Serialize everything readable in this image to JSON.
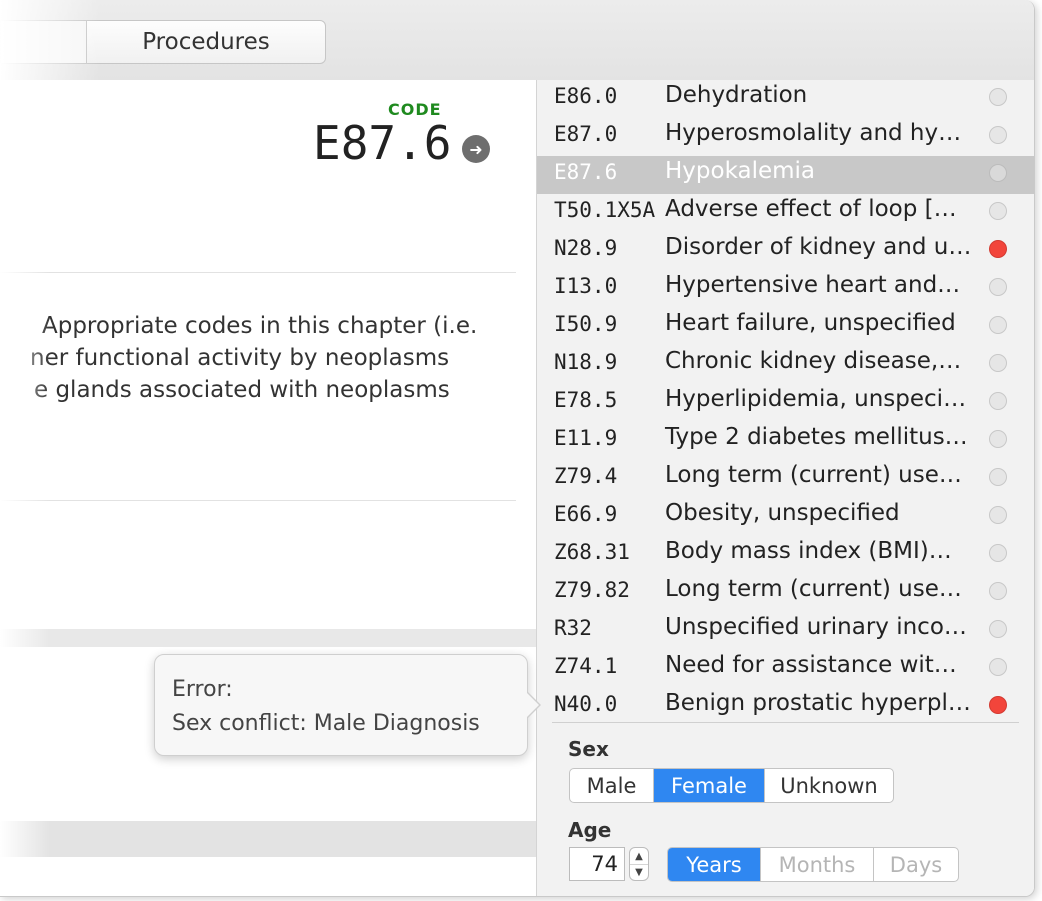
{
  "toolbar": {
    "procedures_tab": "Procedures"
  },
  "detail": {
    "code_label": "CODE",
    "code_value": "E87.6",
    "description_lines": [
      "Appropriate codes in this chapter (i.e.",
      "ner functional activity by neoplasms",
      "e glands associated with neoplasms"
    ]
  },
  "popover": {
    "title": "Error:",
    "message": "Sex conflict: Male Diagnosis"
  },
  "diagnoses": [
    {
      "code": "E86.0",
      "name": "Dehydration",
      "status": "neutral",
      "selected": false
    },
    {
      "code": "E87.0",
      "name": "Hyperosmolality and hy…",
      "status": "neutral",
      "selected": false
    },
    {
      "code": "E87.6",
      "name": "Hypokalemia",
      "status": "neutral",
      "selected": true
    },
    {
      "code": "T50.1X5A",
      "name": "Adverse effect of loop […",
      "status": "neutral",
      "selected": false
    },
    {
      "code": "N28.9",
      "name": "Disorder of kidney and u…",
      "status": "error",
      "selected": false
    },
    {
      "code": "I13.0",
      "name": "Hypertensive heart and…",
      "status": "neutral",
      "selected": false
    },
    {
      "code": "I50.9",
      "name": "Heart failure, unspecified",
      "status": "neutral",
      "selected": false
    },
    {
      "code": "N18.9",
      "name": "Chronic kidney disease,…",
      "status": "neutral",
      "selected": false
    },
    {
      "code": "E78.5",
      "name": "Hyperlipidemia, unspeci…",
      "status": "neutral",
      "selected": false
    },
    {
      "code": "E11.9",
      "name": "Type 2 diabetes mellitus…",
      "status": "neutral",
      "selected": false
    },
    {
      "code": "Z79.4",
      "name": "Long term (current) use…",
      "status": "neutral",
      "selected": false
    },
    {
      "code": "E66.9",
      "name": "Obesity, unspecified",
      "status": "neutral",
      "selected": false
    },
    {
      "code": "Z68.31",
      "name": "Body mass index (BMI)…",
      "status": "neutral",
      "selected": false
    },
    {
      "code": "Z79.82",
      "name": "Long term (current) use…",
      "status": "neutral",
      "selected": false
    },
    {
      "code": "R32",
      "name": "Unspecified urinary inco…",
      "status": "neutral",
      "selected": false
    },
    {
      "code": "Z74.1",
      "name": "Need for assistance wit…",
      "status": "neutral",
      "selected": false
    },
    {
      "code": "N40.0",
      "name": "Benign prostatic hyperpl…",
      "status": "error",
      "selected": false
    }
  ],
  "patient": {
    "sex_label": "Sex",
    "sex_options": [
      "Male",
      "Female",
      "Unknown"
    ],
    "sex_selected": "Female",
    "age_label": "Age",
    "age_value": "74",
    "age_units": [
      "Years",
      "Months",
      "Days"
    ],
    "age_unit_selected": "Years"
  },
  "colors": {
    "accent": "#2f87f1",
    "error_dot": "#f2453b",
    "code_label": "#1f8a1f"
  }
}
